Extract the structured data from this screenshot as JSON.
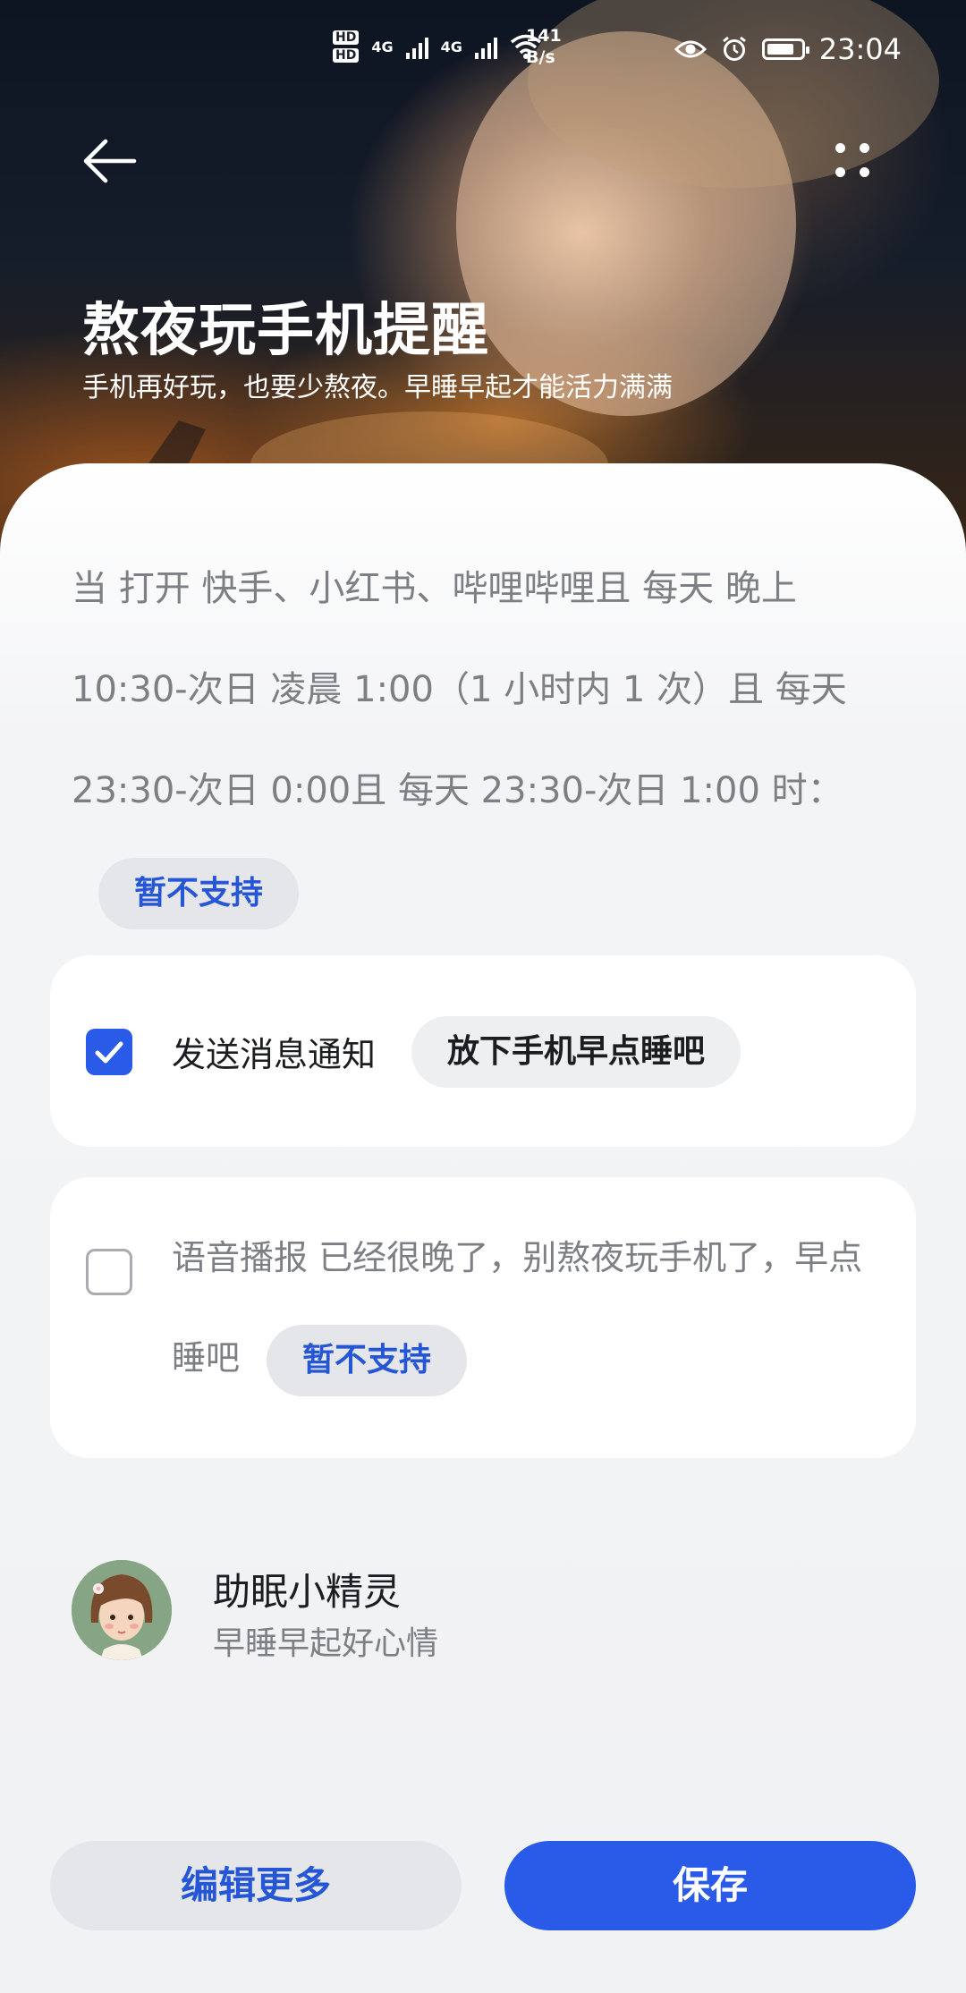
{
  "status_bar": {
    "hd1": "HD",
    "hd2": "HD",
    "net1": "4G",
    "net2": "4G",
    "speed_value": "141",
    "speed_unit": "B/s",
    "time": "23:04"
  },
  "header": {
    "title": "熬夜玩手机提醒",
    "subtitle": "手机再好玩，也要少熬夜。早睡早起才能活力满满"
  },
  "condition": {
    "text": "当 打开 快手、小红书、哔哩哔哩且 每天 晚上 10:30-次日 凌晨 1:00（1 小时内 1 次）且 每天 23:30-次日 0:00且 每天 23:30-次日 1:00 时：",
    "chip": "暂不支持"
  },
  "notify_card": {
    "checked": true,
    "label": "发送消息通知",
    "message": "放下手机早点睡吧"
  },
  "voice_card": {
    "checked": false,
    "text": "语音播报 已经很晚了，别熬夜玩手机了，早点睡吧",
    "chip": "暂不支持"
  },
  "helper": {
    "name": "助眠小精灵",
    "subtitle": "早睡早起好心情"
  },
  "buttons": {
    "edit_more": "编辑更多",
    "save": "保存"
  },
  "colors": {
    "accent": "#2a5ae8",
    "accent_text": "#2556d6",
    "background": "#f1f2f4"
  }
}
